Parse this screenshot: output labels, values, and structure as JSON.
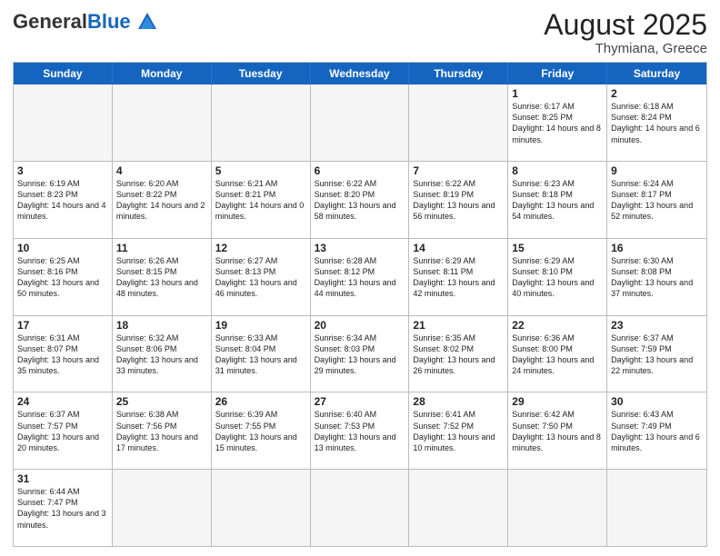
{
  "header": {
    "logo_general": "General",
    "logo_blue": "Blue",
    "month_year": "August 2025",
    "location": "Thymiana, Greece"
  },
  "weekdays": [
    "Sunday",
    "Monday",
    "Tuesday",
    "Wednesday",
    "Thursday",
    "Friday",
    "Saturday"
  ],
  "rows": [
    [
      {
        "day": "",
        "info": "",
        "empty": true
      },
      {
        "day": "",
        "info": "",
        "empty": true
      },
      {
        "day": "",
        "info": "",
        "empty": true
      },
      {
        "day": "",
        "info": "",
        "empty": true
      },
      {
        "day": "",
        "info": "",
        "empty": true
      },
      {
        "day": "1",
        "info": "Sunrise: 6:17 AM\nSunset: 8:25 PM\nDaylight: 14 hours\nand 8 minutes."
      },
      {
        "day": "2",
        "info": "Sunrise: 6:18 AM\nSunset: 8:24 PM\nDaylight: 14 hours\nand 6 minutes."
      }
    ],
    [
      {
        "day": "3",
        "info": "Sunrise: 6:19 AM\nSunset: 8:23 PM\nDaylight: 14 hours\nand 4 minutes."
      },
      {
        "day": "4",
        "info": "Sunrise: 6:20 AM\nSunset: 8:22 PM\nDaylight: 14 hours\nand 2 minutes."
      },
      {
        "day": "5",
        "info": "Sunrise: 6:21 AM\nSunset: 8:21 PM\nDaylight: 14 hours\nand 0 minutes."
      },
      {
        "day": "6",
        "info": "Sunrise: 6:22 AM\nSunset: 8:20 PM\nDaylight: 13 hours\nand 58 minutes."
      },
      {
        "day": "7",
        "info": "Sunrise: 6:22 AM\nSunset: 8:19 PM\nDaylight: 13 hours\nand 56 minutes."
      },
      {
        "day": "8",
        "info": "Sunrise: 6:23 AM\nSunset: 8:18 PM\nDaylight: 13 hours\nand 54 minutes."
      },
      {
        "day": "9",
        "info": "Sunrise: 6:24 AM\nSunset: 8:17 PM\nDaylight: 13 hours\nand 52 minutes."
      }
    ],
    [
      {
        "day": "10",
        "info": "Sunrise: 6:25 AM\nSunset: 8:16 PM\nDaylight: 13 hours\nand 50 minutes."
      },
      {
        "day": "11",
        "info": "Sunrise: 6:26 AM\nSunset: 8:15 PM\nDaylight: 13 hours\nand 48 minutes."
      },
      {
        "day": "12",
        "info": "Sunrise: 6:27 AM\nSunset: 8:13 PM\nDaylight: 13 hours\nand 46 minutes."
      },
      {
        "day": "13",
        "info": "Sunrise: 6:28 AM\nSunset: 8:12 PM\nDaylight: 13 hours\nand 44 minutes."
      },
      {
        "day": "14",
        "info": "Sunrise: 6:29 AM\nSunset: 8:11 PM\nDaylight: 13 hours\nand 42 minutes."
      },
      {
        "day": "15",
        "info": "Sunrise: 6:29 AM\nSunset: 8:10 PM\nDaylight: 13 hours\nand 40 minutes."
      },
      {
        "day": "16",
        "info": "Sunrise: 6:30 AM\nSunset: 8:08 PM\nDaylight: 13 hours\nand 37 minutes."
      }
    ],
    [
      {
        "day": "17",
        "info": "Sunrise: 6:31 AM\nSunset: 8:07 PM\nDaylight: 13 hours\nand 35 minutes."
      },
      {
        "day": "18",
        "info": "Sunrise: 6:32 AM\nSunset: 8:06 PM\nDaylight: 13 hours\nand 33 minutes."
      },
      {
        "day": "19",
        "info": "Sunrise: 6:33 AM\nSunset: 8:04 PM\nDaylight: 13 hours\nand 31 minutes."
      },
      {
        "day": "20",
        "info": "Sunrise: 6:34 AM\nSunset: 8:03 PM\nDaylight: 13 hours\nand 29 minutes."
      },
      {
        "day": "21",
        "info": "Sunrise: 6:35 AM\nSunset: 8:02 PM\nDaylight: 13 hours\nand 26 minutes."
      },
      {
        "day": "22",
        "info": "Sunrise: 6:36 AM\nSunset: 8:00 PM\nDaylight: 13 hours\nand 24 minutes."
      },
      {
        "day": "23",
        "info": "Sunrise: 6:37 AM\nSunset: 7:59 PM\nDaylight: 13 hours\nand 22 minutes."
      }
    ],
    [
      {
        "day": "24",
        "info": "Sunrise: 6:37 AM\nSunset: 7:57 PM\nDaylight: 13 hours\nand 20 minutes."
      },
      {
        "day": "25",
        "info": "Sunrise: 6:38 AM\nSunset: 7:56 PM\nDaylight: 13 hours\nand 17 minutes."
      },
      {
        "day": "26",
        "info": "Sunrise: 6:39 AM\nSunset: 7:55 PM\nDaylight: 13 hours\nand 15 minutes."
      },
      {
        "day": "27",
        "info": "Sunrise: 6:40 AM\nSunset: 7:53 PM\nDaylight: 13 hours\nand 13 minutes."
      },
      {
        "day": "28",
        "info": "Sunrise: 6:41 AM\nSunset: 7:52 PM\nDaylight: 13 hours\nand 10 minutes."
      },
      {
        "day": "29",
        "info": "Sunrise: 6:42 AM\nSunset: 7:50 PM\nDaylight: 13 hours\nand 8 minutes."
      },
      {
        "day": "30",
        "info": "Sunrise: 6:43 AM\nSunset: 7:49 PM\nDaylight: 13 hours\nand 6 minutes."
      }
    ],
    [
      {
        "day": "31",
        "info": "Sunrise: 6:44 AM\nSunset: 7:47 PM\nDaylight: 13 hours\nand 3 minutes."
      },
      {
        "day": "",
        "info": "",
        "empty": true
      },
      {
        "day": "",
        "info": "",
        "empty": true
      },
      {
        "day": "",
        "info": "",
        "empty": true
      },
      {
        "day": "",
        "info": "",
        "empty": true
      },
      {
        "day": "",
        "info": "",
        "empty": true
      },
      {
        "day": "",
        "info": "",
        "empty": true
      }
    ]
  ]
}
